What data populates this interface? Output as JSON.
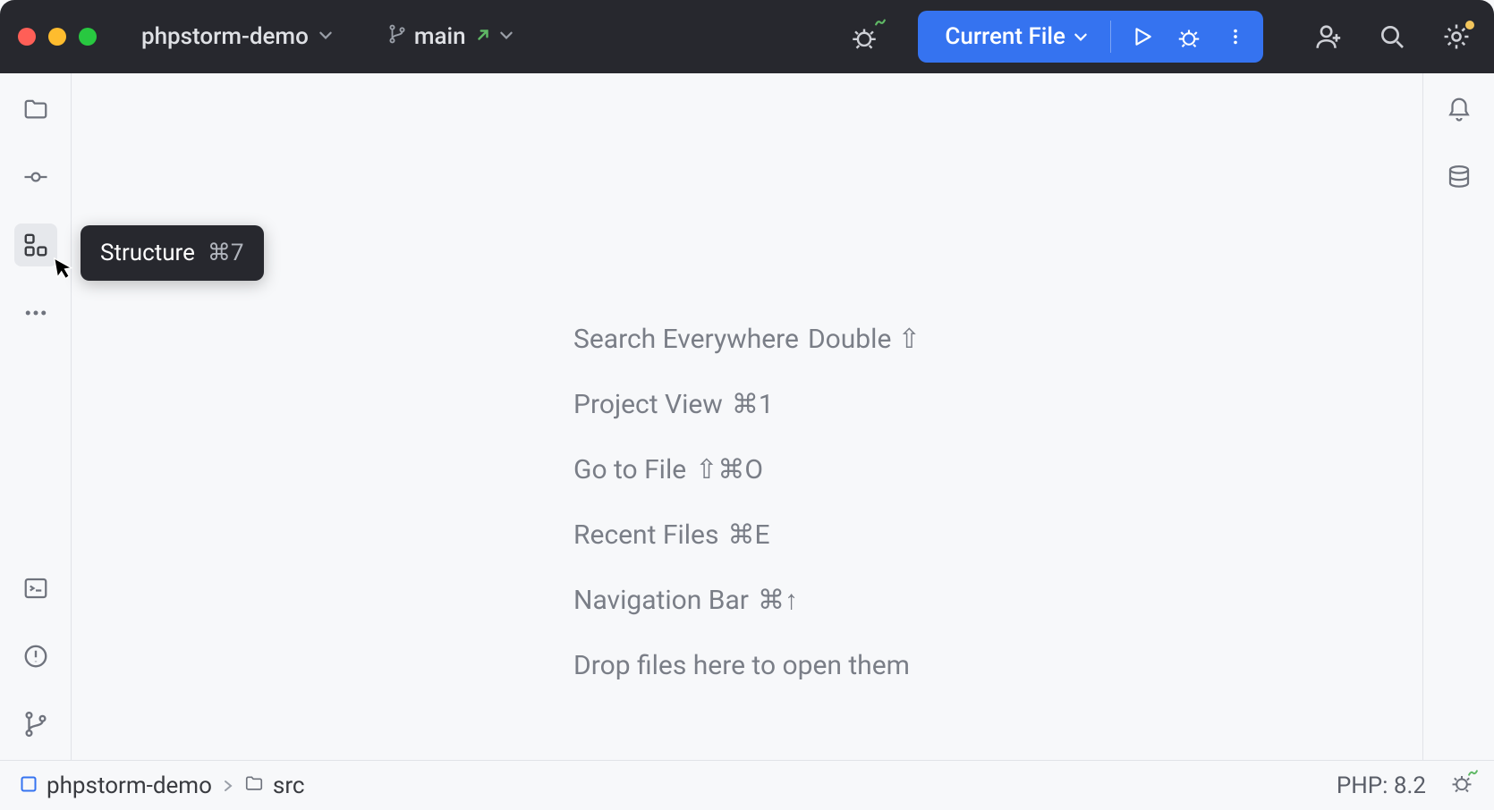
{
  "titlebar": {
    "project_name": "phpstorm-demo",
    "branch_name": "main",
    "run_config_label": "Current File"
  },
  "tooltip": {
    "label": "Structure",
    "shortcut": "⌘7"
  },
  "hints": [
    {
      "label": "Search Everywhere",
      "shortcut": "Double ⇧"
    },
    {
      "label": "Project View",
      "shortcut": "⌘1"
    },
    {
      "label": "Go to File",
      "shortcut": "⇧⌘O"
    },
    {
      "label": "Recent Files",
      "shortcut": "⌘E"
    },
    {
      "label": "Navigation Bar",
      "shortcut": "⌘↑"
    },
    {
      "label": "Drop files here to open them",
      "shortcut": ""
    }
  ],
  "breadcrumbs": {
    "project": "phpstorm-demo",
    "folder": "src"
  },
  "statusbar": {
    "php_version": "PHP: 8.2"
  }
}
